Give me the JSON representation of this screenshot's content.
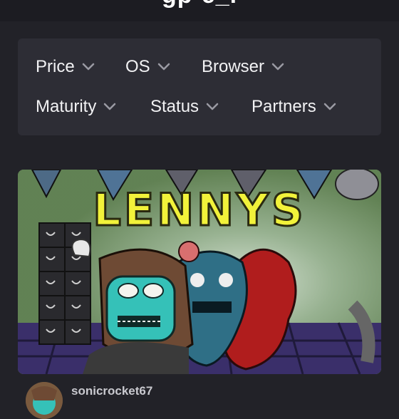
{
  "header": {
    "title": "gp-e_l"
  },
  "filters": [
    {
      "label": "Price"
    },
    {
      "label": "OS"
    },
    {
      "label": "Browser"
    },
    {
      "label": "Maturity"
    },
    {
      "label": "Status"
    },
    {
      "label": "Partners"
    }
  ],
  "card": {
    "cover_title": "LENNYS",
    "author": "sonicrocket67"
  },
  "colors": {
    "background": "#222228",
    "panel": "#2d2d35",
    "cover_title": "#f2f23a"
  },
  "icons": {
    "dropdown": "chevron-down-icon"
  }
}
